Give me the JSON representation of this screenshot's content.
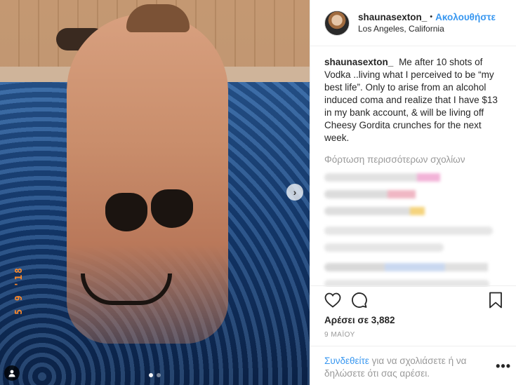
{
  "post": {
    "username": "shaunasexton_",
    "separator": "•",
    "follow_label": "Ακολουθήστε",
    "location": "Los Angeles, California",
    "caption": "Me after 10 shots of Vodka ..living what I perceived to be “my best life”. Only to arise from an alcohol induced coma and realize that I have $13 in my bank account, & will be living off Cheesy Gordita crunches for the next week.",
    "load_more_comments": "Φόρτωση περισσότερων σχολίων",
    "likes": "Αρέσει σε 3,882",
    "date": "9 ΜΑΪΟΥ",
    "login_link": "Συνδεθείτε",
    "login_text": " για να σχολιάσετε ή να δηλώσετε ότι σας αρέσει.",
    "more_options": "•••"
  },
  "photo": {
    "date_stamp": "5 9 '18",
    "carousel_dots": 2,
    "active_dot": 1,
    "next_icon": "chevron-right-icon",
    "tag_icon": "user-tag-icon"
  },
  "actions": {
    "like_icon": "heart-icon",
    "comment_icon": "comment-icon",
    "save_icon": "bookmark-icon"
  },
  "colors": {
    "accent": "#3897f0",
    "muted": "#999999",
    "text": "#262626"
  }
}
